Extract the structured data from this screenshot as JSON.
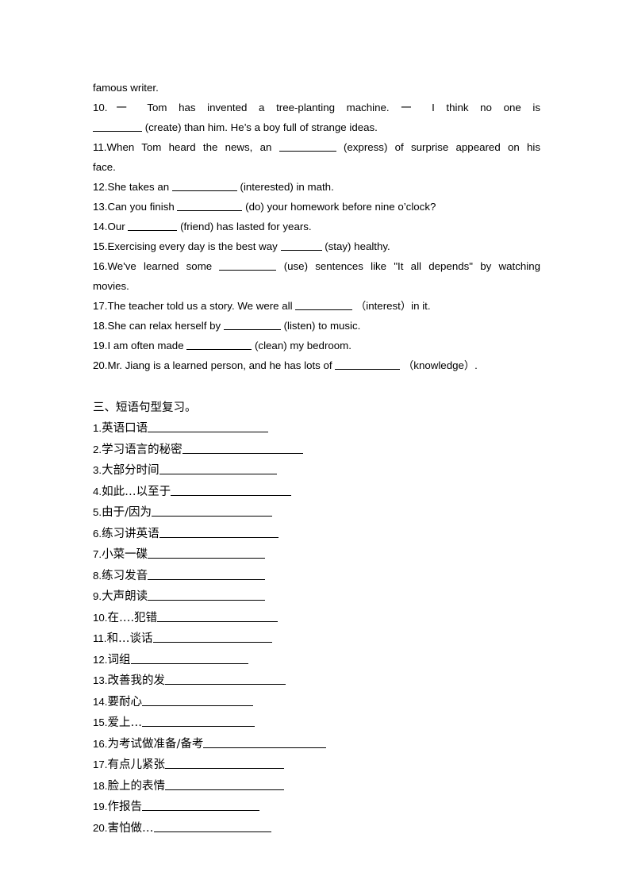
{
  "document": {
    "page_background": "#ffffff",
    "text_color": "#000000"
  },
  "english_section": {
    "continuation_line": "famous writer.",
    "items": [
      {
        "number": "10.",
        "segments": [
          {
            "type": "text",
            "value": "一 Tom has invented a tree-planting machine. 一 I think no one is"
          }
        ],
        "justified": true
      },
      {
        "number": "",
        "segments": [
          {
            "type": "blank",
            "size": "md"
          },
          {
            "type": "text",
            "value": "(create) than him. He’s a boy full of strange ideas."
          }
        ],
        "justified": false
      },
      {
        "number": "11.",
        "segments": [
          {
            "type": "text",
            "value": "When Tom heard the news, an"
          },
          {
            "type": "blank",
            "size": "lg"
          },
          {
            "type": "text",
            "value": "(express) of surprise appeared on his"
          }
        ],
        "justified": true
      },
      {
        "number": "",
        "segments": [
          {
            "type": "text",
            "value": "face."
          }
        ],
        "justified": false
      },
      {
        "number": "12.",
        "segments": [
          {
            "type": "text",
            "value": "She takes an"
          },
          {
            "type": "blank",
            "size": "xl"
          },
          {
            "type": "text",
            "value": "(interested) in math."
          }
        ],
        "justified": false
      },
      {
        "number": "13.",
        "segments": [
          {
            "type": "text",
            "value": "Can you finish"
          },
          {
            "type": "blank",
            "size": "xl"
          },
          {
            "type": "text",
            "value": "(do) your homework before nine o’clock?"
          }
        ],
        "justified": false
      },
      {
        "number": "14.",
        "segments": [
          {
            "type": "text",
            "value": "Our"
          },
          {
            "type": "blank",
            "size": "md"
          },
          {
            "type": "text",
            "value": "(friend) has lasted for years."
          }
        ],
        "justified": false
      },
      {
        "number": "15.",
        "segments": [
          {
            "type": "text",
            "value": "Exercising every day is the best way"
          },
          {
            "type": "blank",
            "size": "sm"
          },
          {
            "type": "text",
            "value": "(stay) healthy."
          }
        ],
        "justified": false
      },
      {
        "number": "16.",
        "segments": [
          {
            "type": "text",
            "value": "We've learned some"
          },
          {
            "type": "blank",
            "size": "lg"
          },
          {
            "type": "text",
            "value": "(use) sentences like \"It all depends\" by watching"
          }
        ],
        "justified": true
      },
      {
        "number": "",
        "segments": [
          {
            "type": "text",
            "value": "movies."
          }
        ],
        "justified": false
      },
      {
        "number": "17.",
        "segments": [
          {
            "type": "text",
            "value": "The teacher told us a story. We were all"
          },
          {
            "type": "blank",
            "size": "lg"
          },
          {
            "type": "text",
            "value": "（interest）in it."
          }
        ],
        "justified": false
      },
      {
        "number": "18.",
        "segments": [
          {
            "type": "text",
            "value": "She can relax herself by"
          },
          {
            "type": "blank",
            "size": "lg"
          },
          {
            "type": "text",
            "value": "(listen) to music."
          }
        ],
        "justified": false
      },
      {
        "number": "19.",
        "segments": [
          {
            "type": "text",
            "value": "I am often made"
          },
          {
            "type": "blank",
            "size": "xl"
          },
          {
            "type": "text",
            "value": "(clean) my bedroom."
          }
        ],
        "justified": false
      },
      {
        "number": "20.",
        "segments": [
          {
            "type": "text",
            "value": "Mr. Jiang is a learned person, and he has lots of"
          },
          {
            "type": "blank",
            "size": "xl"
          },
          {
            "type": "text",
            "value": "（knowledge）."
          }
        ],
        "justified": false
      }
    ]
  },
  "chinese_section": {
    "heading": "三、短语句型复习。",
    "items": [
      {
        "number": "1.",
        "phrase": "英语口语",
        "blank_width": 152
      },
      {
        "number": "2.",
        "phrase": "学习语言的秘密",
        "blank_width": 152
      },
      {
        "number": "3.",
        "phrase": "大部分时间",
        "blank_width": 148
      },
      {
        "number": "4.",
        "phrase": "如此…以至于",
        "blank_width": 152
      },
      {
        "number": "5.",
        "phrase": "由于/因为",
        "blank_width": 152
      },
      {
        "number": "6.",
        "phrase": "练习讲英语",
        "blank_width": 150
      },
      {
        "number": "7.",
        "phrase": "小菜一碟",
        "blank_width": 148
      },
      {
        "number": "8.",
        "phrase": "练习发音",
        "blank_width": 148
      },
      {
        "number": "9.",
        "phrase": "大声朗读",
        "blank_width": 148
      },
      {
        "number": "10.",
        "phrase": "在….犯错",
        "blank_width": 152
      },
      {
        "number": "11.",
        "phrase": "和…谈话",
        "blank_width": 150
      },
      {
        "number": "12.",
        "phrase": "词组",
        "blank_width": 148
      },
      {
        "number": "13.",
        "phrase": "改善我的发",
        "blank_width": 152
      },
      {
        "number": "14.",
        "phrase": "要耐心",
        "blank_width": 140
      },
      {
        "number": "15.",
        "phrase": "爱上…",
        "blank_width": 142
      },
      {
        "number": "16.",
        "phrase": "为考试做准备/备考",
        "blank_width": 155
      },
      {
        "number": "17.",
        "phrase": "有点儿紧张",
        "blank_width": 150
      },
      {
        "number": "18.",
        "phrase": "脸上的表情",
        "blank_width": 150
      },
      {
        "number": "19.",
        "phrase": "作报告",
        "blank_width": 148
      },
      {
        "number": "20.",
        "phrase": "害怕做…",
        "blank_width": 148
      }
    ]
  }
}
